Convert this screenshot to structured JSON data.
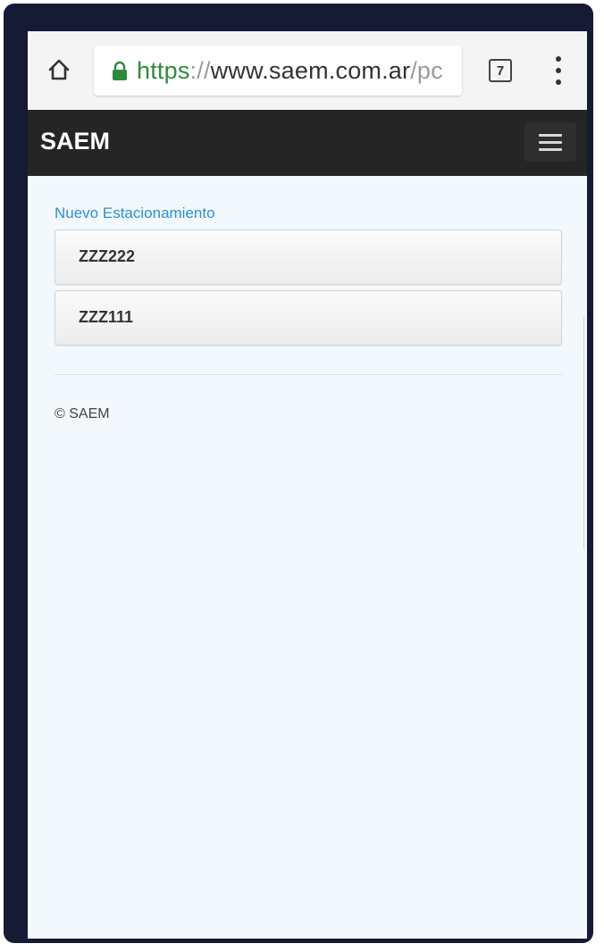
{
  "browser": {
    "url_scheme": "https",
    "url_separator": "://",
    "url_host": "www.saem.com.ar",
    "url_path": "/pc",
    "tab_count": "7"
  },
  "navbar": {
    "brand": "SAEM"
  },
  "main": {
    "section_link": "Nuevo Estacionamiento",
    "items": [
      {
        "label": "ZZZ222"
      },
      {
        "label": "ZZZ111"
      }
    ]
  },
  "footer": {
    "text": "© SAEM"
  },
  "colors": {
    "navbar_bg": "#252525",
    "link": "#2e8fd6",
    "secure_green": "#2e8b3c",
    "page_bg": "#f2f8fb"
  },
  "icons": {
    "home": "home-icon",
    "lock": "lock-icon",
    "tabs": "tabs-icon",
    "overflow_menu": "more-vert-icon",
    "nav_toggle": "hamburger-icon"
  }
}
